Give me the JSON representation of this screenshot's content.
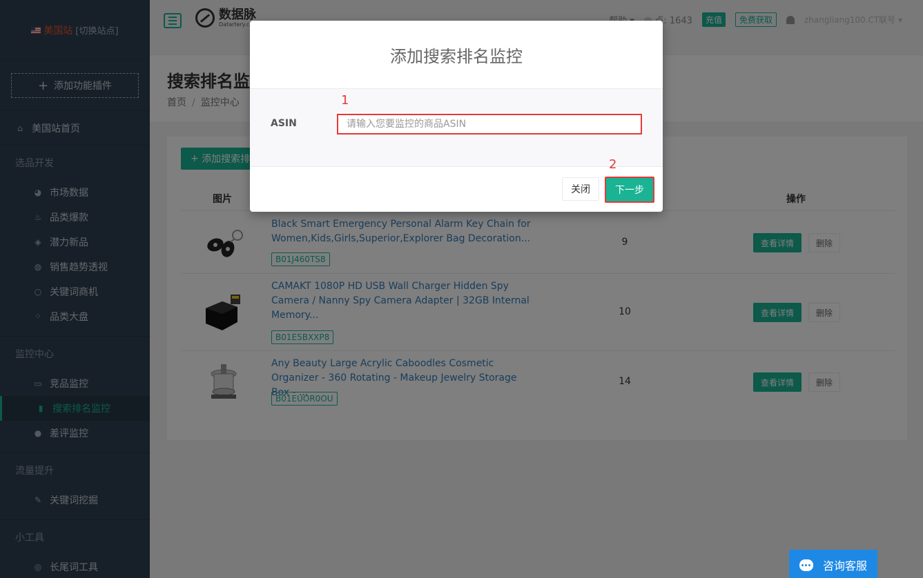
{
  "colors": {
    "accent": "#1ab394",
    "sidebar_bg": "#2f4050",
    "annotation": "#e53935",
    "chat": "#1e88e5"
  },
  "sidebar": {
    "site_name": "美国站",
    "switch_label": "[切换站点]",
    "add_plugin": "添加功能插件",
    "home": "美国站首页",
    "sections": [
      {
        "title": "选品开发",
        "items": [
          {
            "label": "市场数据",
            "icon": "pie-chart-icon"
          },
          {
            "label": "品类爆款",
            "icon": "fire-icon"
          },
          {
            "label": "潜力新品",
            "icon": "tag-icon"
          },
          {
            "label": "销售趋势透视",
            "icon": "globe-icon"
          },
          {
            "label": "关键词商机",
            "icon": "lightbulb-icon"
          },
          {
            "label": "品类大盘",
            "icon": "grid-icon"
          }
        ]
      },
      {
        "title": "监控中心",
        "items": [
          {
            "label": "竞品监控",
            "icon": "monitor-icon"
          },
          {
            "label": "搜索排名监控",
            "icon": "bar-chart-icon",
            "active": true
          },
          {
            "label": "差评监控",
            "icon": "user-icon"
          }
        ]
      },
      {
        "title": "流量提升",
        "items": [
          {
            "label": "关键词挖掘",
            "icon": "pencil-icon"
          }
        ]
      },
      {
        "title": "小工具",
        "items": [
          {
            "label": "长尾词工具",
            "icon": "target-icon"
          }
        ]
      }
    ]
  },
  "topbar": {
    "logo_cn": "数据脉",
    "logo_en": "Datartery.com",
    "help": "帮助",
    "points": "点: 1643",
    "recharge": "充值",
    "free": "免费获取",
    "user": "zhangliang100.CT联号"
  },
  "page": {
    "title": "搜索排名监控",
    "breadcrumb": [
      "首页",
      "监控中心"
    ]
  },
  "table": {
    "add_button": "添加搜索排名监控",
    "headers": {
      "image": "图片",
      "actions": "操作"
    },
    "detail_label": "查看详情",
    "delete_label": "删除",
    "rows": [
      {
        "title": "Black Smart Emergency Personal Alarm Key Chain for Women,Kids,Girls,Superior,Explorer Bag Decoration...",
        "asin": "B01J460TS8",
        "rank": "9",
        "image_icon": "keychain-icon"
      },
      {
        "title": "CAMAKT 1080P HD USB Wall Charger Hidden Spy Camera / Nanny Spy Camera Adapter | 32GB Internal Memory...",
        "asin": "B01E5BXXP8",
        "rank": "10",
        "image_icon": "charger-camera-icon"
      },
      {
        "title": "Any Beauty Large Acrylic Caboodles Cosmetic Organizer - 360 Rotating - Makeup Jewelry Storage Box - ...",
        "asin": "B01EUOR0OU",
        "rank": "14",
        "image_icon": "organizer-icon"
      }
    ]
  },
  "modal": {
    "title": "添加搜索排名监控",
    "asin_label": "ASIN",
    "asin_placeholder": "请输入您要监控的商品ASIN",
    "asin_value": "",
    "annotation_1": "1",
    "annotation_2": "2",
    "close_label": "关闭",
    "next_label": "下一步"
  },
  "chat": {
    "label": "咨询客服"
  }
}
